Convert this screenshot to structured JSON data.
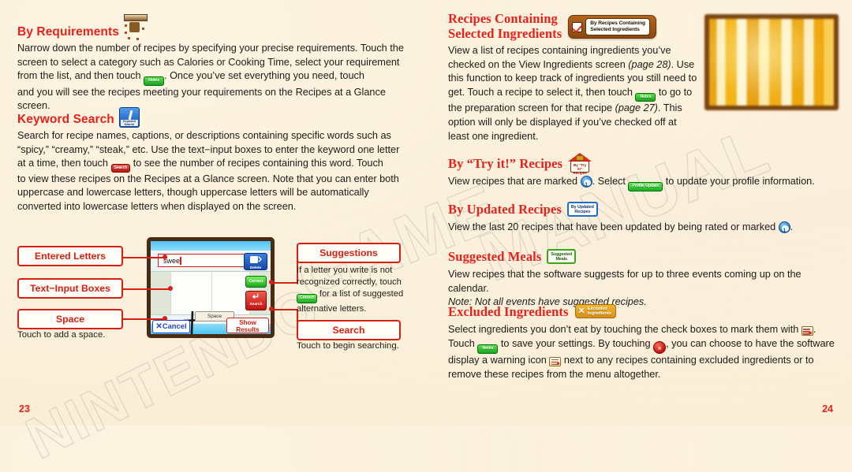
{
  "watermarks": {
    "w1": "NINTENDO",
    "w2": "®",
    "w3": "GAME",
    "w4": "MANUAL"
  },
  "left_page": {
    "page_number": "23",
    "sections": [
      {
        "heading": "By Requirements",
        "icon": "requirements-icon",
        "body_parts": [
          "Narrow down the number of recipes by specifying your precise requirements. Touch the screen to select a category such as Calories or Cooking Time, select your requirement from the list, and then touch ",
          ". Once you’ve set everything you need, touch ",
          " and you will see the recipes meeting your requirements on the Recipes at a Glance screen."
        ],
        "inline_buttons": [
          {
            "name": "notes-button",
            "label": "Notes"
          }
        ]
      },
      {
        "heading": "Keyword Search",
        "icon": "keyword-search-icon",
        "icon_label": "Keyword\nSearch",
        "body_parts": [
          "Search for recipe names, captions, or descriptions containing specific words such as “spicy,” “creamy,” “steak,” etc. Use the text−input boxes to enter the keyword one letter at a time, then touch ",
          " to see the number of recipes containing this word. Touch ",
          " to view these recipes on the Recipes at a Glance screen. Note that you can enter both uppercase and lowercase letters, though uppercase letters will be automatically converted into lowercase letters when displayed on the screen."
        ],
        "inline_buttons": [
          {
            "name": "search-button",
            "label": "Search"
          }
        ]
      }
    ],
    "diagram": {
      "screen": {
        "entered_text": "swee",
        "delete_button": "Delete",
        "correct_button": "Correct",
        "search_button": "Search",
        "space_button": "Space",
        "cancel_button": "Cancel",
        "show_results_button": "Show\nResults"
      },
      "callouts": [
        {
          "name": "entered-letters",
          "label": "Entered Letters",
          "caption": ""
        },
        {
          "name": "text-input-boxes",
          "label": "Text−Input Boxes",
          "caption": ""
        },
        {
          "name": "space",
          "label": "Space",
          "caption": "Touch to add a space."
        },
        {
          "name": "suggestions",
          "label": "Suggestions",
          "caption_parts": [
            "If a letter you write is not recognized correctly, touch ",
            " for a list of suggested alternative letters."
          ],
          "inline_button": "Correct"
        },
        {
          "name": "search",
          "label": "Search",
          "caption": "Touch to begin searching."
        }
      ]
    }
  },
  "right_page": {
    "page_number": "24",
    "sections": [
      {
        "heading": "Recipes Containing\nSelected Ingredients",
        "badge": "By Recipes Containing\nSelected Ingredients",
        "badge_icon": "checkbox-checked-icon",
        "body_parts": [
          "View a list of recipes containing ingredients you’ve checked on the View Ingredients screen ",
          "(page 28)",
          ". Use this function to keep track of ingredients you still need to get. Touch a recipe to select it, then touch ",
          " to go to the preparation screen for that recipe ",
          "(page 27)",
          ". This option will only be displayed if you’ve checked off at least one ingredient."
        ],
        "inline_buttons": [
          {
            "name": "notes-button",
            "label": "Notes"
          }
        ]
      },
      {
        "heading": "By “Try it!” Recipes",
        "badge_icon": "try-it-house-icon",
        "badge_label": "By “Try it!”\nRecipes",
        "body_parts": [
          "View recipes that are marked ",
          ". Select ",
          " to update your profile information."
        ],
        "inline_buttons": [
          {
            "name": "clock-icon",
            "label": ""
          },
          {
            "name": "profile-update-button",
            "label": "Profile Update"
          }
        ]
      },
      {
        "heading": "By Updated Recipes",
        "badge_icon": "updated-recipes-icon",
        "badge_label": "By Updated\nRecipes",
        "body_parts": [
          "View the last 20 recipes that have been updated by being rated or marked ",
          "."
        ]
      },
      {
        "heading": "Suggested Meals",
        "badge_icon": "suggested-meals-icon",
        "badge_label": "Suggested\nMeals",
        "body_parts": [
          "View recipes that the software suggests for up to three events coming up on the calendar."
        ],
        "note": "Note: Not all events have suggested recipes."
      },
      {
        "heading": "Excluded Ingredients",
        "badge_icon": "excluded-ingredients-icon",
        "badge_label": "Excluded\nIngredients",
        "body_parts": [
          "Select ingredients you don’t eat by touching the check boxes to mark them with ",
          ". Touch ",
          " to save your settings. By touching ",
          ", you can choose to have the software display a warning icon ",
          " next to any recipes containing excluded ingredients or to remove these recipes from the menu altogether."
        ],
        "inline_buttons": [
          {
            "name": "warning-note-icon",
            "label": ""
          },
          {
            "name": "notes-button",
            "label": "Notes"
          },
          {
            "name": "double-chevron-button",
            "label": "»"
          }
        ]
      }
    ]
  },
  "colors": {
    "heading_red": "#e8211a",
    "callout_red": "#d81f12",
    "body_text": "#201a16",
    "paper": "#fbf1dd"
  }
}
